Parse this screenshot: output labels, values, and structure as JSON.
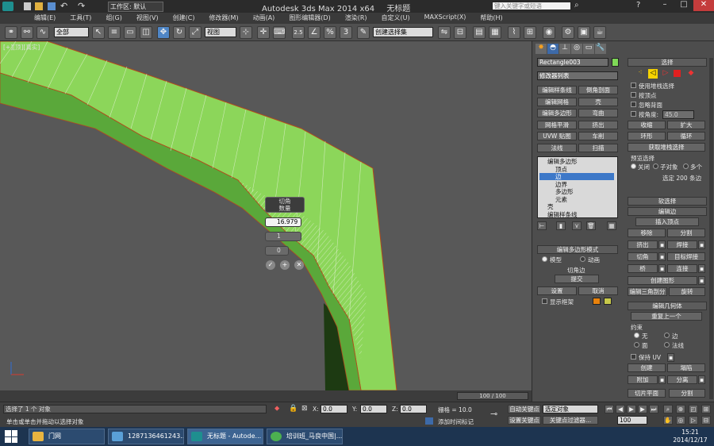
{
  "title": {
    "workspace_label": "工作区: 默认",
    "app": "Autodesk 3ds Max  2014 x64",
    "file": "无标题",
    "search_placeholder": "键入关键字或短语"
  },
  "menu": [
    "编辑(E)",
    "工具(T)",
    "组(G)",
    "视图(V)",
    "创建(C)",
    "修改器(M)",
    "动画(A)",
    "图形编辑器(D)",
    "渲染(R)",
    "自定义(U)",
    "MAXScript(X)",
    "帮助(H)"
  ],
  "toolbar": {
    "filter": "全部",
    "refcoord": "视图",
    "selection_set": "创建选择集",
    "snap_angle": "2.5",
    "snap_percent": "%",
    "snap_spinner": "3"
  },
  "viewport": {
    "label": "[+][顶][真实]",
    "caddy_title": "切角",
    "caddy_subtitle": "数量",
    "caddy_amount": "16.979",
    "caddy_segments": "1",
    "caddy_tension": "0"
  },
  "timeline": {
    "frame": "100 / 100"
  },
  "cmd": {
    "object_name": "Rectangle003",
    "object_color": "#7fd957",
    "modifier_list": "修改器列表",
    "mod_buttons": [
      "编辑样条线",
      "倒角剖面",
      "编辑网格",
      "壳",
      "编辑多边形",
      "弯曲",
      "网格平滑",
      "挤出",
      "UVW 贴图",
      "车削",
      "法线",
      "扫描"
    ],
    "stack": [
      "编辑多边形",
      "顶点",
      "边",
      "边界",
      "多边形",
      "元素",
      "壳",
      "编辑样条线"
    ],
    "stack_selected": "边",
    "edit_poly_mode": "编辑多边形模式",
    "model": "模型",
    "animate": "动画",
    "chamfer_edge": "切角边",
    "commit": "提交",
    "settings": "设置",
    "cancel": "取消",
    "show_cage": "显示框架",
    "cage_colors": [
      "#e8820c",
      "#c7c94a"
    ]
  },
  "sel": {
    "header": "选择",
    "by_vertex": "使用堆栈选择",
    "by_vertex2": "按顶点",
    "ignore_back": "忽略背面",
    "by_angle": "按角度:",
    "angle": "45.0",
    "shrink": "收缩",
    "grow": "扩大",
    "ring": "环形",
    "loop": "循环",
    "get_stack": "获取堆栈选择",
    "preview": "预览选择",
    "off": "关闭",
    "subobj": "子对象",
    "multi": "多个",
    "selected": "选定 200 条边",
    "soft": "软选择",
    "edit_edges": "编辑边",
    "insert_vertex": "插入顶点",
    "remove": "移除",
    "split": "分割",
    "extrude": "挤出",
    "weld": "焊接",
    "chamfer": "切角",
    "target_weld": "目标焊接",
    "bridge": "桥",
    "connect": "连接",
    "create_shape": "创建图形",
    "edit_tri": "编辑三角剖分",
    "turn": "旋转",
    "edit_geom": "编辑几何体",
    "repeat": "重复上一个",
    "constraints": "约束",
    "none": "无",
    "edge": "边",
    "face": "面",
    "normal": "法线",
    "keep_uv": "保持 UV",
    "create": "创建",
    "collapse": "塌陷",
    "attach": "附加",
    "detach": "分离",
    "slice_plane": "切片平面",
    "split2": "分割"
  },
  "status": {
    "selected": "选择了 1 个 对象",
    "prompt": "单击或单击并拖动以选择对象",
    "x": "0.0",
    "y": "0.0",
    "z": "0.0",
    "grid": "栅格 = 10.0",
    "add_time_tag": "添加时间标记",
    "auto_key": "自动关键点",
    "set_key": "设置关键点",
    "sel_obj": "选定对象",
    "key_filters": "关键点过滤器...",
    "frame": "100"
  },
  "taskbar": {
    "start": "",
    "tasks": [
      "门网",
      "1287136461243...",
      "无标题 - Autode...",
      "培训班_马良中国|..."
    ],
    "time": "15:21",
    "date": "2014/12/17"
  }
}
